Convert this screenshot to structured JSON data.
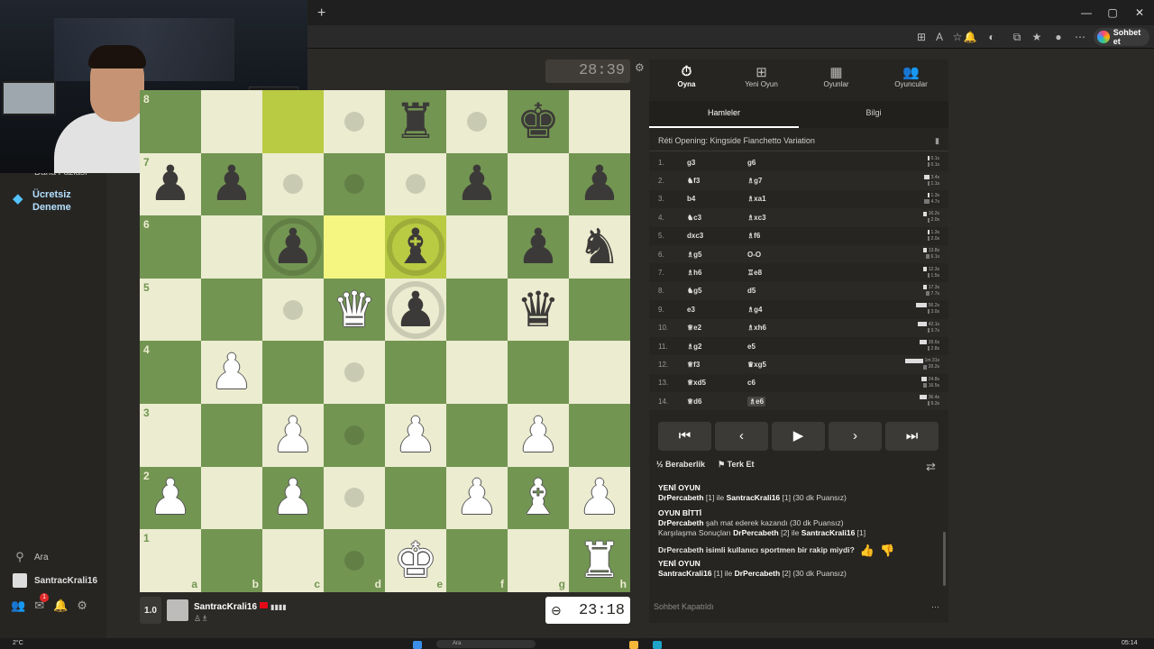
{
  "browser": {
    "copilot_label": "Sohbet et"
  },
  "sidebar": {
    "items_top_partial": "Daha Fazlası",
    "premium_label_1": "Ücretsiz",
    "premium_label_2": "Deneme",
    "search_label": "Ara",
    "username": "SantracKrali16",
    "mail_badge": "1"
  },
  "board": {
    "ranks": [
      "1",
      "2",
      "3",
      "4",
      "5",
      "6",
      "7",
      "8"
    ],
    "files": [
      "a",
      "b",
      "c",
      "d",
      "e",
      "f",
      "g",
      "h"
    ],
    "pieces": {
      "e8": "br",
      "g8": "bk",
      "a7": "bp",
      "b7": "bp",
      "f7": "bp",
      "h7": "bp",
      "c6": "bp",
      "e6": "bb",
      "g6": "bp",
      "h6": "bn",
      "d5": "wq",
      "e5": "bp",
      "g5": "bq",
      "b4": "wp",
      "c3": "wp",
      "e3": "wp",
      "g3": "wp",
      "a2": "wp",
      "c2": "wp",
      "f2": "wp",
      "g2": "wb",
      "h2": "wp",
      "e1": "wk",
      "h1": "wr"
    },
    "highlighted": [
      "c8",
      "d6",
      "e6"
    ],
    "move_dots": [
      "d8",
      "f8",
      "c7",
      "d7",
      "e7",
      "c5",
      "d4",
      "d3",
      "d2",
      "d1"
    ],
    "capture_rings": [
      "c6",
      "e6",
      "e5"
    ]
  },
  "opponent": {
    "clock": "28:39"
  },
  "player": {
    "rating_chip": "1.0",
    "name": "SantracKrali16",
    "captured": "♙♗",
    "clock": "23:18"
  },
  "panel": {
    "tabs": [
      {
        "icon": "⏱",
        "label": "Oyna"
      },
      {
        "icon": "⊞",
        "label": "Yeni Oyun"
      },
      {
        "icon": "▦",
        "label": "Oyunlar"
      },
      {
        "icon": "👥",
        "label": "Oyuncular"
      }
    ],
    "subtabs": [
      "Hamleler",
      "Bilgi"
    ],
    "opening": "Réti Opening: Kingside Fianchetto Variation",
    "moves": [
      {
        "n": "1.",
        "w": "g3",
        "b": "g6",
        "tw": "0.1s",
        "tb": "0.1s",
        "bw": 1,
        "bb": 1
      },
      {
        "n": "2.",
        "w": "♞f3",
        "b": "♗g7",
        "tw": "3.4s",
        "tb": "1.1s",
        "bw": 3,
        "bb": 1
      },
      {
        "n": "3.",
        "w": "b4",
        "b": "♗xa1",
        "tw": "1.3s",
        "tb": "4.7s",
        "bw": 1,
        "bb": 3
      },
      {
        "n": "4.",
        "w": "♞c3",
        "b": "♗xc3",
        "tw": "16.2s",
        "tb": "2.0s",
        "bw": 2,
        "bb": 1
      },
      {
        "n": "5.",
        "w": "dxc3",
        "b": "♗f6",
        "tw": "1.3s",
        "tb": "2.0s",
        "bw": 1,
        "bb": 1
      },
      {
        "n": "6.",
        "w": "♗g5",
        "b": "O-O",
        "tw": "13.8s",
        "tb": "6.1s",
        "bw": 2,
        "bb": 2
      },
      {
        "n": "7.",
        "w": "♗h6",
        "b": "♖e8",
        "tw": "12.3s",
        "tb": "1.5s",
        "bw": 2,
        "bb": 1
      },
      {
        "n": "8.",
        "w": "♞g5",
        "b": "d5",
        "tw": "17.3s",
        "tb": "7.7s",
        "bw": 2,
        "bb": 2
      },
      {
        "n": "9.",
        "w": "e3",
        "b": "♗g4",
        "tw": "56.2s",
        "tb": "3.0s",
        "bw": 6,
        "bb": 1
      },
      {
        "n": "10.",
        "w": "♕e2",
        "b": "♗xh6",
        "tw": "42.1s",
        "tb": "3.7s",
        "bw": 5,
        "bb": 1
      },
      {
        "n": "11.",
        "w": "♗g2",
        "b": "e5",
        "tw": "39.6s",
        "tb": "2.8s",
        "bw": 4,
        "bb": 1
      },
      {
        "n": "12.",
        "w": "♕f3",
        "b": "♛xg5",
        "tw": "1m 31s",
        "tb": "20.2s",
        "bw": 10,
        "bb": 2
      },
      {
        "n": "13.",
        "w": "♕xd5",
        "b": "c6",
        "tw": "24.8s",
        "tb": "16.5s",
        "bw": 3,
        "bb": 2
      },
      {
        "n": "14.",
        "w": "♕d6",
        "b": "♗e6",
        "tw": "36.4s",
        "tb": "9.3s",
        "bw": 4,
        "bb": 1
      }
    ],
    "actions": {
      "draw_icon": "½",
      "draw": "Beraberlik",
      "resign_icon": "⚑",
      "resign": "Terk Et"
    },
    "chat": {
      "new_game_1": "YENİ OYUN",
      "line1_a": "DrPercabeth",
      "line1_b": " [1] ile ",
      "line1_c": "SantracKrali16",
      "line1_d": " [1] (30 dk Puansız)",
      "game_over": "OYUN BİTTİ",
      "line2_a": "DrPercabeth",
      "line2_b": " şah mat ederek kazandı (30 dk Puansız)",
      "line3_a": "Karşılaşma Sonuçları ",
      "line3_b": "DrPercabeth",
      "line3_c": " [2] ile ",
      "line3_d": "SantracKrali16",
      "line3_e": " [1]",
      "question": "DrPercabeth isimli kullanıcı sportmen bir rakip miydi?",
      "new_game_2": "YENİ OYUN",
      "line4_a": "SantracKrali16",
      "line4_b": " [1] ile ",
      "line4_c": "DrPercabeth",
      "line4_d": " [2] (30 dk Puansız)"
    },
    "chat_closed": "Sohbet Kapatıldı"
  },
  "taskbar": {
    "weather": "2°C",
    "time": "05:14",
    "search": "Ara"
  },
  "colors": {
    "board_light": "#ebecd0",
    "board_dark": "#739552",
    "highlight": "#f5f682",
    "panel_bg": "#262522"
  }
}
